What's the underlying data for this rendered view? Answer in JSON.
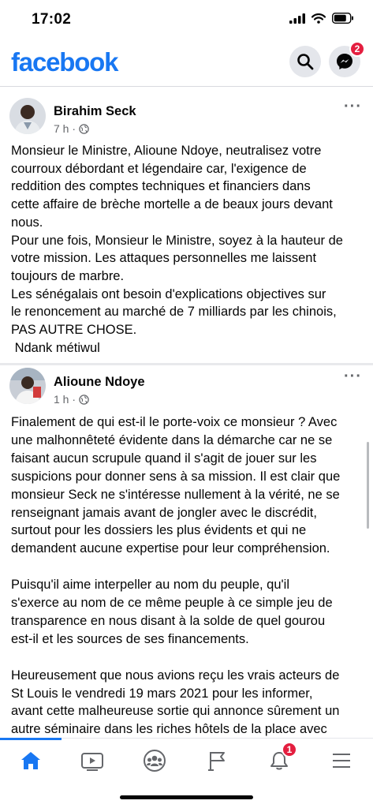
{
  "status_bar": {
    "time": "17:02"
  },
  "header": {
    "logo": "facebook",
    "messenger_badge": "2"
  },
  "post": {
    "author": "Birahim Seck",
    "time": "7 h ·",
    "more": "···",
    "lines": [
      "Monsieur le Ministre, Alioune Ndoye, neutralisez votre",
      "courroux débordant et légendaire car, l'exigence de",
      "reddition des comptes techniques et financiers dans",
      "cette affaire de brèche mortelle a de beaux jours devant",
      "nous.",
      "Pour une fois, Monsieur le Ministre, soyez à la hauteur de",
      "votre mission. Les attaques personnelles me laissent",
      "toujours de marbre.",
      "Les sénégalais ont besoin d'explications objectives sur",
      "le renoncement au marché de 7 milliards par les chinois,",
      "PAS AUTRE CHOSE.",
      " Ndank métiwul"
    ]
  },
  "comment": {
    "author": "Alioune Ndoye",
    "time": "1 h ·",
    "more": "···",
    "paragraphs": [
      {
        "lines": [
          "Finalement de qui est-il le porte-voix ce monsieur ? Avec",
          "une malhonnêteté évidente dans la démarche car ne se",
          "faisant aucun scrupule quand il s'agit de jouer sur les",
          "suspicions pour donner sens à sa mission. Il est clair que",
          "monsieur Seck ne s'intéresse nullement à la vérité, ne se",
          "renseignant jamais avant de jongler avec le discrédit,",
          "surtout pour les dossiers les plus évidents et qui ne",
          "demandent aucune expertise pour leur compréhension."
        ]
      },
      {
        "lines": [
          "Puisqu'il aime interpeller au nom du peuple, qu'il",
          "s'exerce au nom de ce même peuple à ce simple jeu de",
          "transparence en nous disant à la solde de quel gourou",
          "est-il et les sources de ses financements."
        ]
      },
      {
        "lines": [
          "Heureusement que nous avions reçu les vrais acteurs de",
          "St Louis le vendredi 19 mars 2021 pour les informer,",
          "avant cette malheureuse sortie qui annonce sûrement un",
          "autre séminaire dans les riches hôtels de la place avec"
        ]
      }
    ]
  },
  "bottom_nav": {
    "items": [
      "home-icon",
      "watch-icon",
      "groups-icon",
      "pages-flag-icon",
      "notifications-bell-icon",
      "menu-icon"
    ],
    "notifications_badge": "1",
    "accent": "#1877f2"
  }
}
